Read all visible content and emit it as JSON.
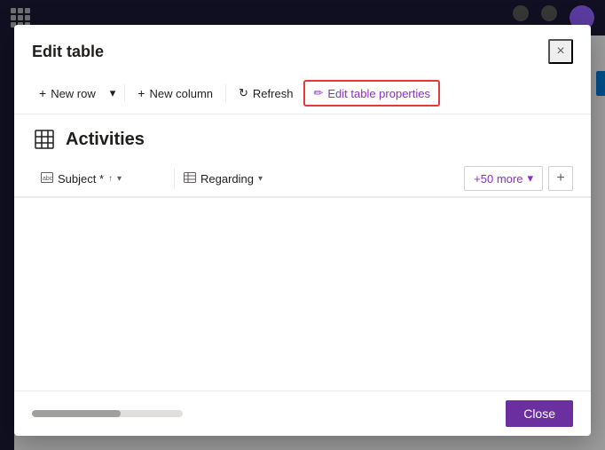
{
  "modal": {
    "title": "Edit table",
    "close_label": "×"
  },
  "toolbar": {
    "new_row_label": "New row",
    "chevron_label": "▾",
    "new_column_label": "New column",
    "refresh_label": "Refresh",
    "edit_table_props_label": "Edit table properties"
  },
  "table": {
    "name": "Activities",
    "icon": "⊞",
    "columns": [
      {
        "label": "Subject *",
        "icon": "🖼",
        "sort": "↑",
        "dropdown": "▾"
      },
      {
        "label": "Regarding",
        "icon": "⊞",
        "dropdown": "▾"
      }
    ],
    "more_cols_label": "+50 more",
    "add_col_label": "+"
  },
  "footer": {
    "close_label": "Close"
  },
  "colors": {
    "accent": "#6b2fa0",
    "highlight_border": "#e53935",
    "edit_props_color": "#8b2fc9"
  }
}
